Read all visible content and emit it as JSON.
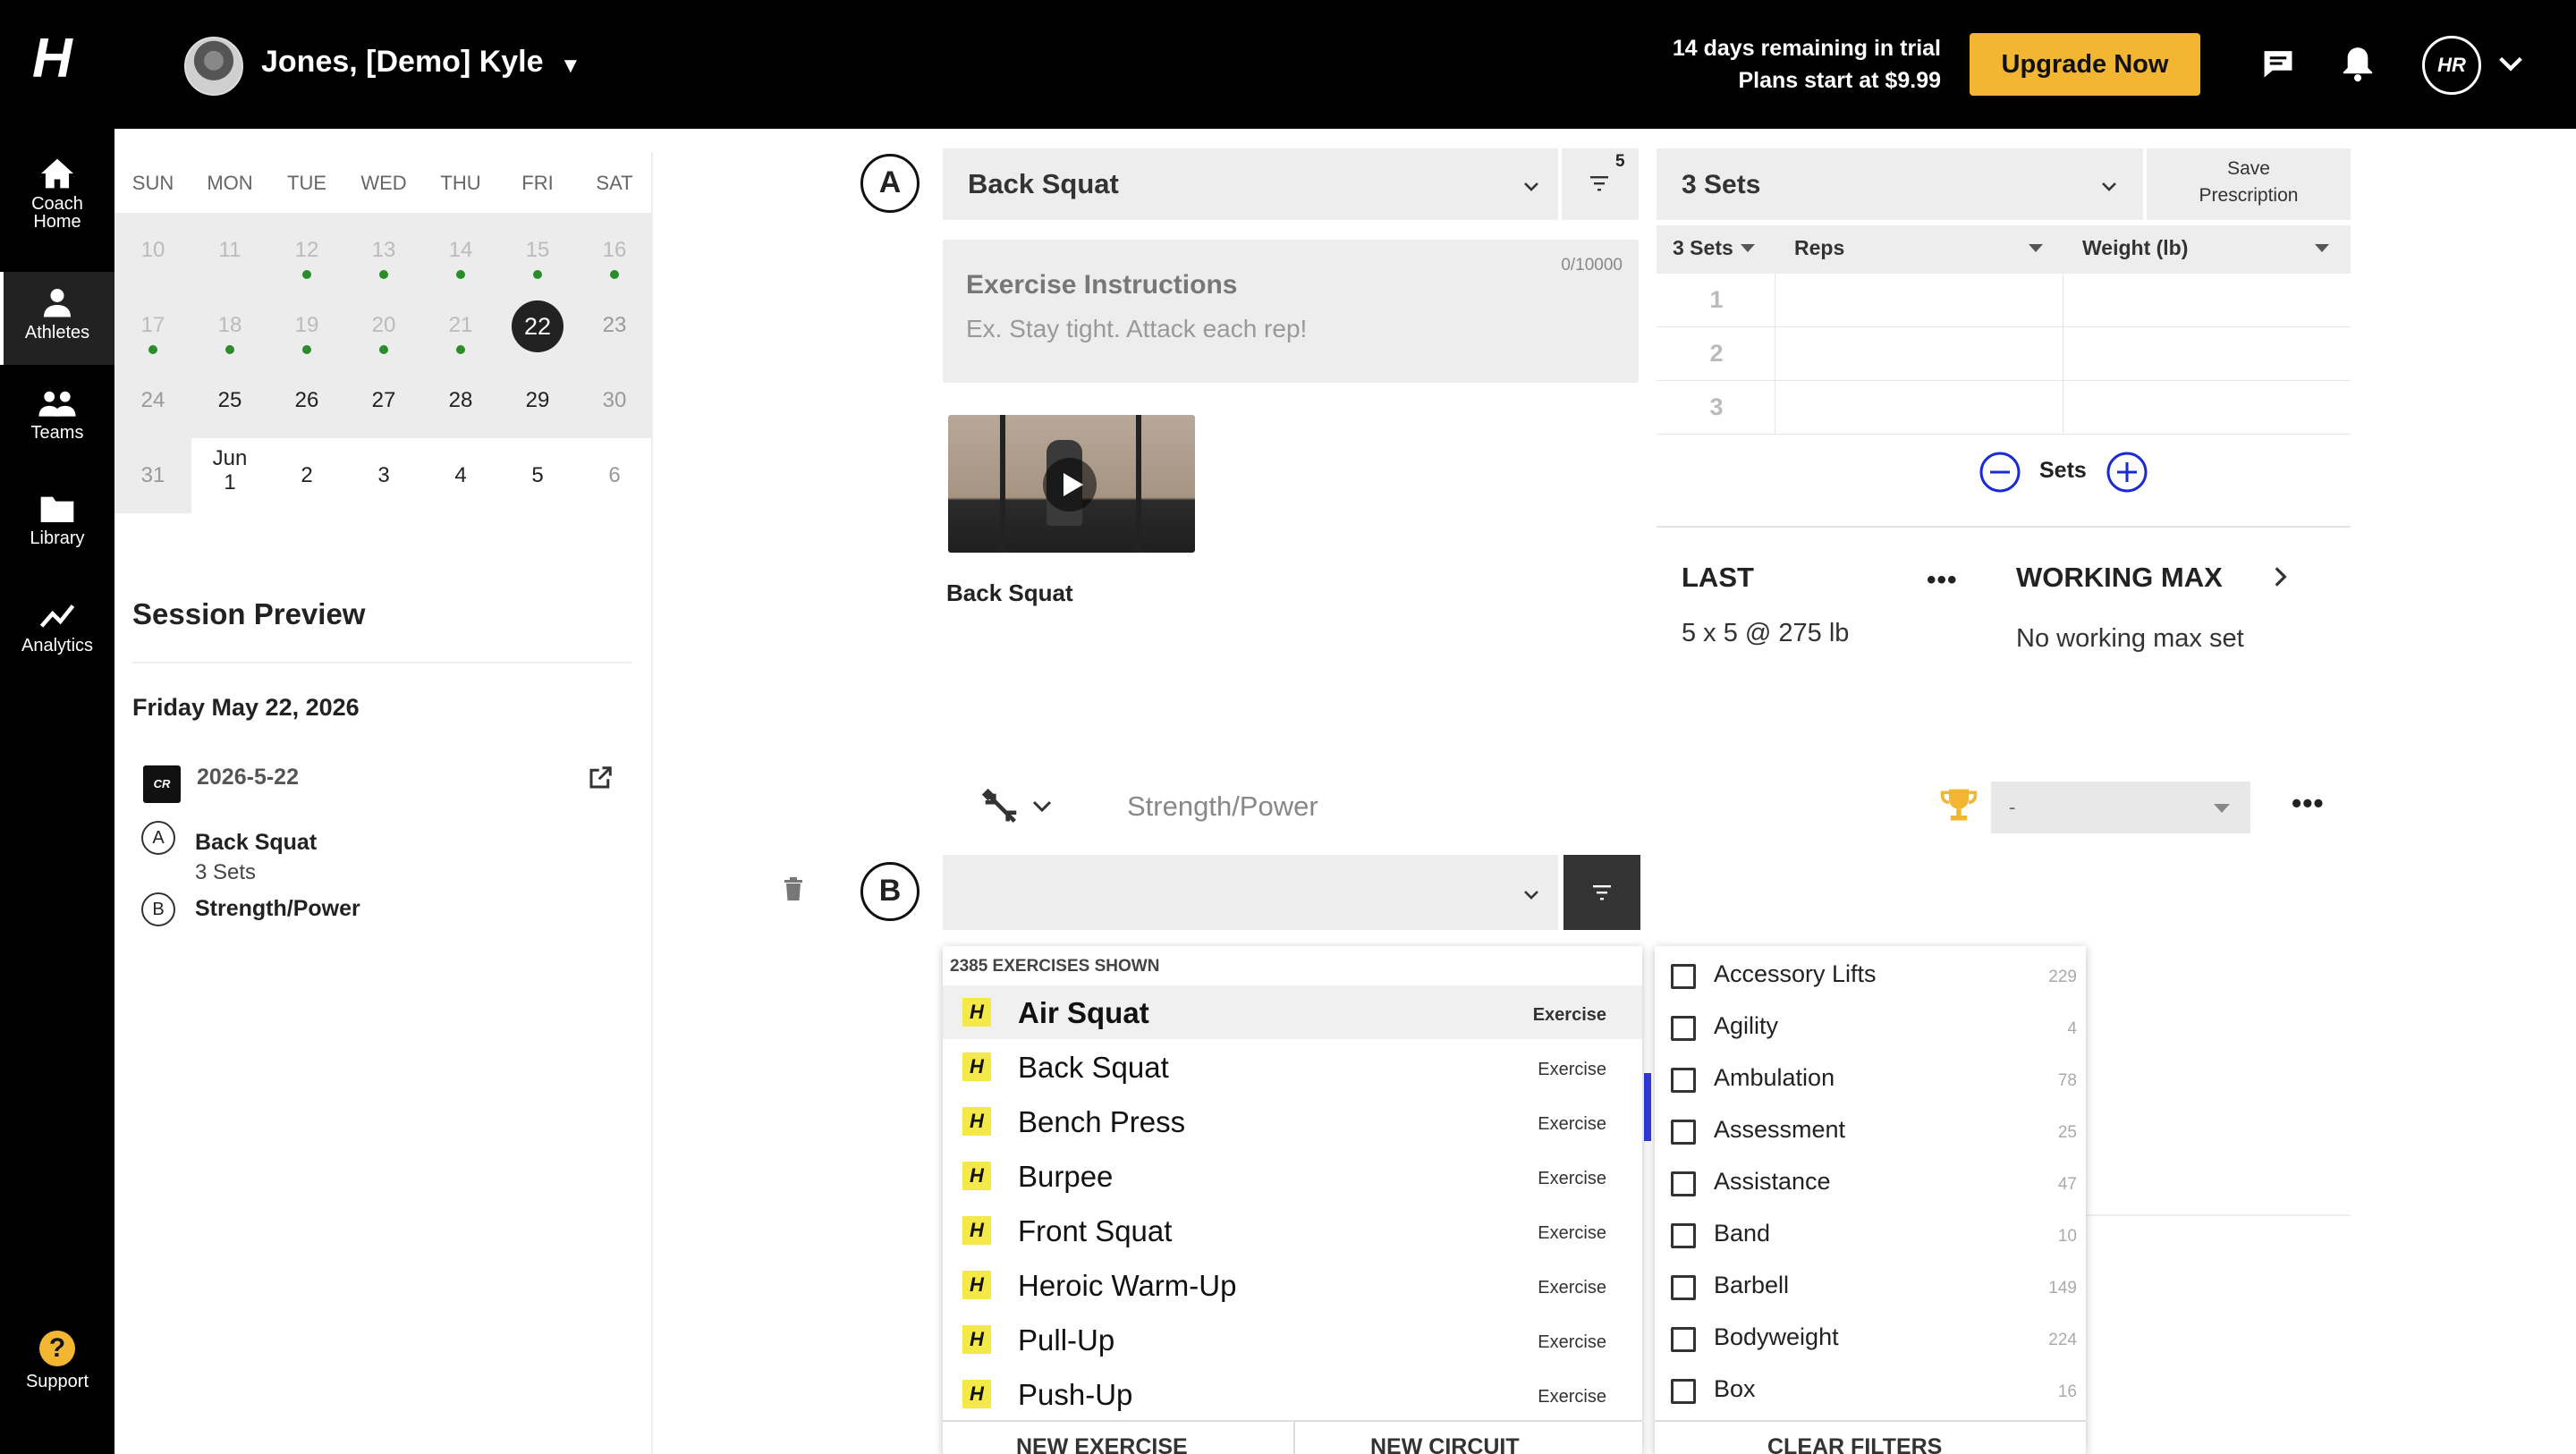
{
  "header": {
    "logo": "H",
    "athlete_name": "Jones, [Demo] Kyle",
    "trial_line1": "14 days remaining in trial",
    "trial_line2": "Plans start at $9.99",
    "upgrade_label": "Upgrade Now",
    "user_initials": "HR"
  },
  "nav": {
    "items": [
      {
        "label1": "Coach",
        "label2": "Home",
        "icon": "home-icon"
      },
      {
        "label": "Athletes",
        "icon": "person-icon"
      },
      {
        "label": "Teams",
        "icon": "group-icon"
      },
      {
        "label": "Library",
        "icon": "folder-icon"
      },
      {
        "label": "Analytics",
        "icon": "trend-icon"
      }
    ],
    "support_label": "Support",
    "support_glyph": "?"
  },
  "calendar": {
    "weekdays": [
      "SUN",
      "MON",
      "TUE",
      "WED",
      "THU",
      "FRI",
      "SAT"
    ],
    "rows": [
      [
        "10",
        "11",
        "12",
        "13",
        "14",
        "15",
        "16"
      ],
      [
        "17",
        "18",
        "19",
        "20",
        "21",
        "22",
        "23"
      ],
      [
        "24",
        "25",
        "26",
        "27",
        "28",
        "29",
        "30"
      ],
      [
        "31",
        "1",
        "2",
        "3",
        "4",
        "5",
        "6"
      ]
    ],
    "month_label": "Jun"
  },
  "session": {
    "title": "Session Preview",
    "date": "Friday May 22, 2026",
    "badge": "CR",
    "code": "2026-5-22",
    "items": [
      {
        "letter": "A",
        "name": "Back Squat",
        "detail": "3 Sets"
      },
      {
        "letter": "B",
        "name": "Strength/Power"
      }
    ]
  },
  "exercise_a": {
    "letter": "A",
    "name": "Back Squat",
    "filter_count": "5",
    "instructions_label": "Exercise Instructions",
    "instructions_placeholder": "Ex. Stay tight. Attack each rep!",
    "instructions_counter": "0/10000",
    "video_label": "Back Squat"
  },
  "prescription": {
    "sets_select": "3 Sets",
    "save_line1": "Save",
    "save_line2": "Prescription",
    "columns": [
      "3 Sets",
      "Reps",
      "Weight (lb)"
    ],
    "rows": [
      "1",
      "2",
      "3"
    ],
    "sets_label": "Sets",
    "last_title": "LAST",
    "last_value": "5 x 5 @ 275 lb",
    "working_max_title": "WORKING MAX",
    "working_max_value": "No working max set",
    "more": "•••"
  },
  "circuit": {
    "name": "Strength/Power",
    "scoring_value": "-",
    "more": "•••"
  },
  "exercise_b": {
    "letter": "B"
  },
  "dropdown": {
    "shown_count": "2385 EXERCISES SHOWN",
    "options": [
      {
        "name": "Air Squat",
        "type": "Exercise"
      },
      {
        "name": "Back Squat",
        "type": "Exercise"
      },
      {
        "name": "Bench Press",
        "type": "Exercise"
      },
      {
        "name": "Burpee",
        "type": "Exercise"
      },
      {
        "name": "Front Squat",
        "type": "Exercise"
      },
      {
        "name": "Heroic Warm-Up",
        "type": "Exercise"
      },
      {
        "name": "Pull-Up",
        "type": "Exercise"
      },
      {
        "name": "Push-Up",
        "type": "Exercise"
      }
    ],
    "new_exercise": "NEW EXERCISE",
    "new_circuit": "NEW CIRCUIT"
  },
  "filters": {
    "items": [
      {
        "name": "Accessory Lifts",
        "count": "229"
      },
      {
        "name": "Agility",
        "count": "4"
      },
      {
        "name": "Ambulation",
        "count": "78"
      },
      {
        "name": "Assessment",
        "count": "25"
      },
      {
        "name": "Assistance",
        "count": "47"
      },
      {
        "name": "Band",
        "count": "10"
      },
      {
        "name": "Barbell",
        "count": "149"
      },
      {
        "name": "Bodyweight",
        "count": "224"
      },
      {
        "name": "Box",
        "count": "16"
      }
    ],
    "clear_label": "CLEAR FILTERS"
  },
  "colors": {
    "accent": "#f2b632",
    "calendar_dot": "#2a8c2a",
    "sets_control": "#1a2bd6",
    "logo_tile": "#f5e94a"
  }
}
